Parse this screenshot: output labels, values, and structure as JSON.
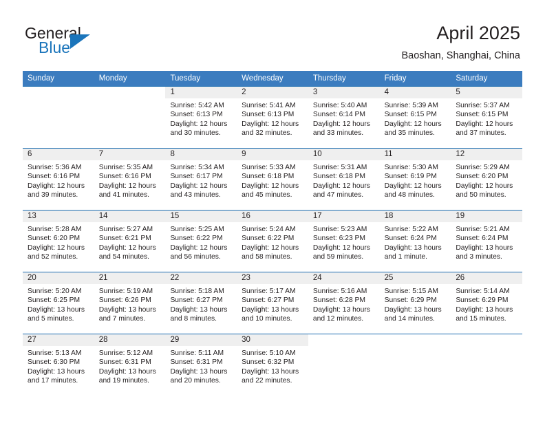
{
  "brand": {
    "name_part1": "General",
    "name_part2": "Blue",
    "logo_icon": "blue-triangle-icon"
  },
  "header": {
    "title": "April 2025",
    "location": "Baoshan, Shanghai, China"
  },
  "theme": {
    "header_blue": "#3b7cbf",
    "row_border_blue": "#1b6cb0",
    "daynum_band": "#efefef",
    "brand_blue": "#1b75bb",
    "text": "#231f20"
  },
  "weekdays": [
    "Sunday",
    "Monday",
    "Tuesday",
    "Wednesday",
    "Thursday",
    "Friday",
    "Saturday"
  ],
  "weeks": [
    [
      {
        "empty": true
      },
      {
        "empty": true
      },
      {
        "day": "1",
        "sunrise": "Sunrise: 5:42 AM",
        "sunset": "Sunset: 6:13 PM",
        "daylight": "Daylight: 12 hours and 30 minutes."
      },
      {
        "day": "2",
        "sunrise": "Sunrise: 5:41 AM",
        "sunset": "Sunset: 6:13 PM",
        "daylight": "Daylight: 12 hours and 32 minutes."
      },
      {
        "day": "3",
        "sunrise": "Sunrise: 5:40 AM",
        "sunset": "Sunset: 6:14 PM",
        "daylight": "Daylight: 12 hours and 33 minutes."
      },
      {
        "day": "4",
        "sunrise": "Sunrise: 5:39 AM",
        "sunset": "Sunset: 6:15 PM",
        "daylight": "Daylight: 12 hours and 35 minutes."
      },
      {
        "day": "5",
        "sunrise": "Sunrise: 5:37 AM",
        "sunset": "Sunset: 6:15 PM",
        "daylight": "Daylight: 12 hours and 37 minutes."
      }
    ],
    [
      {
        "day": "6",
        "sunrise": "Sunrise: 5:36 AM",
        "sunset": "Sunset: 6:16 PM",
        "daylight": "Daylight: 12 hours and 39 minutes."
      },
      {
        "day": "7",
        "sunrise": "Sunrise: 5:35 AM",
        "sunset": "Sunset: 6:16 PM",
        "daylight": "Daylight: 12 hours and 41 minutes."
      },
      {
        "day": "8",
        "sunrise": "Sunrise: 5:34 AM",
        "sunset": "Sunset: 6:17 PM",
        "daylight": "Daylight: 12 hours and 43 minutes."
      },
      {
        "day": "9",
        "sunrise": "Sunrise: 5:33 AM",
        "sunset": "Sunset: 6:18 PM",
        "daylight": "Daylight: 12 hours and 45 minutes."
      },
      {
        "day": "10",
        "sunrise": "Sunrise: 5:31 AM",
        "sunset": "Sunset: 6:18 PM",
        "daylight": "Daylight: 12 hours and 47 minutes."
      },
      {
        "day": "11",
        "sunrise": "Sunrise: 5:30 AM",
        "sunset": "Sunset: 6:19 PM",
        "daylight": "Daylight: 12 hours and 48 minutes."
      },
      {
        "day": "12",
        "sunrise": "Sunrise: 5:29 AM",
        "sunset": "Sunset: 6:20 PM",
        "daylight": "Daylight: 12 hours and 50 minutes."
      }
    ],
    [
      {
        "day": "13",
        "sunrise": "Sunrise: 5:28 AM",
        "sunset": "Sunset: 6:20 PM",
        "daylight": "Daylight: 12 hours and 52 minutes."
      },
      {
        "day": "14",
        "sunrise": "Sunrise: 5:27 AM",
        "sunset": "Sunset: 6:21 PM",
        "daylight": "Daylight: 12 hours and 54 minutes."
      },
      {
        "day": "15",
        "sunrise": "Sunrise: 5:25 AM",
        "sunset": "Sunset: 6:22 PM",
        "daylight": "Daylight: 12 hours and 56 minutes."
      },
      {
        "day": "16",
        "sunrise": "Sunrise: 5:24 AM",
        "sunset": "Sunset: 6:22 PM",
        "daylight": "Daylight: 12 hours and 58 minutes."
      },
      {
        "day": "17",
        "sunrise": "Sunrise: 5:23 AM",
        "sunset": "Sunset: 6:23 PM",
        "daylight": "Daylight: 12 hours and 59 minutes."
      },
      {
        "day": "18",
        "sunrise": "Sunrise: 5:22 AM",
        "sunset": "Sunset: 6:24 PM",
        "daylight": "Daylight: 13 hours and 1 minute."
      },
      {
        "day": "19",
        "sunrise": "Sunrise: 5:21 AM",
        "sunset": "Sunset: 6:24 PM",
        "daylight": "Daylight: 13 hours and 3 minutes."
      }
    ],
    [
      {
        "day": "20",
        "sunrise": "Sunrise: 5:20 AM",
        "sunset": "Sunset: 6:25 PM",
        "daylight": "Daylight: 13 hours and 5 minutes."
      },
      {
        "day": "21",
        "sunrise": "Sunrise: 5:19 AM",
        "sunset": "Sunset: 6:26 PM",
        "daylight": "Daylight: 13 hours and 7 minutes."
      },
      {
        "day": "22",
        "sunrise": "Sunrise: 5:18 AM",
        "sunset": "Sunset: 6:27 PM",
        "daylight": "Daylight: 13 hours and 8 minutes."
      },
      {
        "day": "23",
        "sunrise": "Sunrise: 5:17 AM",
        "sunset": "Sunset: 6:27 PM",
        "daylight": "Daylight: 13 hours and 10 minutes."
      },
      {
        "day": "24",
        "sunrise": "Sunrise: 5:16 AM",
        "sunset": "Sunset: 6:28 PM",
        "daylight": "Daylight: 13 hours and 12 minutes."
      },
      {
        "day": "25",
        "sunrise": "Sunrise: 5:15 AM",
        "sunset": "Sunset: 6:29 PM",
        "daylight": "Daylight: 13 hours and 14 minutes."
      },
      {
        "day": "26",
        "sunrise": "Sunrise: 5:14 AM",
        "sunset": "Sunset: 6:29 PM",
        "daylight": "Daylight: 13 hours and 15 minutes."
      }
    ],
    [
      {
        "day": "27",
        "sunrise": "Sunrise: 5:13 AM",
        "sunset": "Sunset: 6:30 PM",
        "daylight": "Daylight: 13 hours and 17 minutes."
      },
      {
        "day": "28",
        "sunrise": "Sunrise: 5:12 AM",
        "sunset": "Sunset: 6:31 PM",
        "daylight": "Daylight: 13 hours and 19 minutes."
      },
      {
        "day": "29",
        "sunrise": "Sunrise: 5:11 AM",
        "sunset": "Sunset: 6:31 PM",
        "daylight": "Daylight: 13 hours and 20 minutes."
      },
      {
        "day": "30",
        "sunrise": "Sunrise: 5:10 AM",
        "sunset": "Sunset: 6:32 PM",
        "daylight": "Daylight: 13 hours and 22 minutes."
      },
      {
        "empty": true
      },
      {
        "empty": true
      },
      {
        "empty": true
      }
    ]
  ]
}
